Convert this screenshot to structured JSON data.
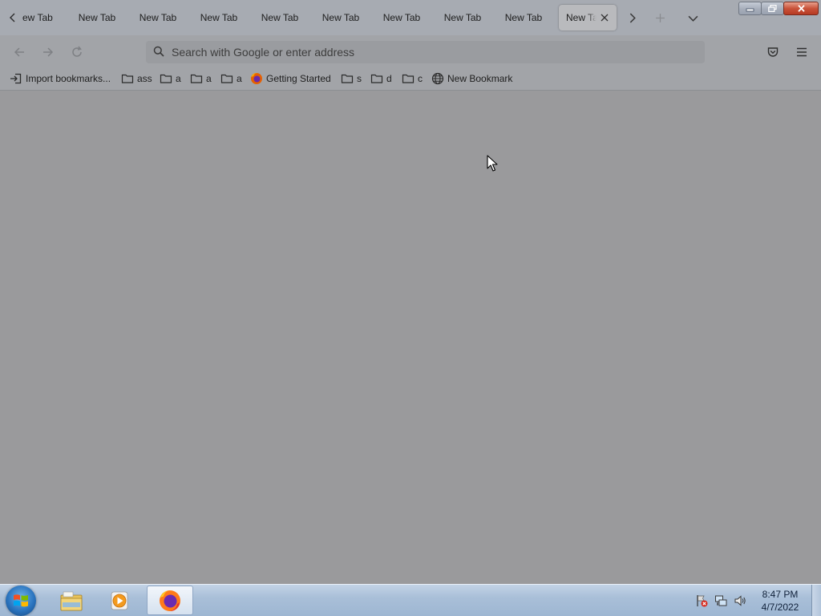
{
  "browser": {
    "tabs": [
      {
        "label": "ew Tab"
      },
      {
        "label": "New Tab"
      },
      {
        "label": "New Tab"
      },
      {
        "label": "New Tab"
      },
      {
        "label": "New Tab"
      },
      {
        "label": "New Tab"
      },
      {
        "label": "New Tab"
      },
      {
        "label": "New Tab"
      },
      {
        "label": "New Tab"
      },
      {
        "label": "New Tab",
        "selected": true
      }
    ],
    "address_bar": {
      "placeholder": "Search with Google or enter address",
      "value": ""
    },
    "bookmarks": [
      {
        "label": "Import bookmarks...",
        "icon": "import-icon"
      },
      {
        "label": "ass",
        "icon": "folder-icon"
      },
      {
        "label": "a",
        "icon": "folder-icon"
      },
      {
        "label": "a",
        "icon": "folder-icon"
      },
      {
        "label": "a",
        "icon": "folder-icon"
      },
      {
        "label": "Getting Started",
        "icon": "firefox-icon"
      },
      {
        "label": "s",
        "icon": "folder-icon"
      },
      {
        "label": "d",
        "icon": "folder-icon"
      },
      {
        "label": "c",
        "icon": "folder-icon"
      },
      {
        "label": "New Bookmark",
        "icon": "globe-icon"
      }
    ]
  },
  "taskbar": {
    "apps": [
      {
        "name": "Windows Explorer",
        "icon": "file-explorer-icon"
      },
      {
        "name": "Windows Media Player",
        "icon": "media-player-icon"
      },
      {
        "name": "Firefox",
        "icon": "firefox-icon",
        "active": true
      }
    ],
    "clock": {
      "time": "8:47 PM",
      "date": "4/7/2022"
    }
  },
  "colors": {
    "content_background": "#9a9a9c",
    "toolbar_background": "#a2a4a8",
    "taskbar_gradient_top": "#c3d3e6",
    "close_button_red": "#c9533a"
  }
}
